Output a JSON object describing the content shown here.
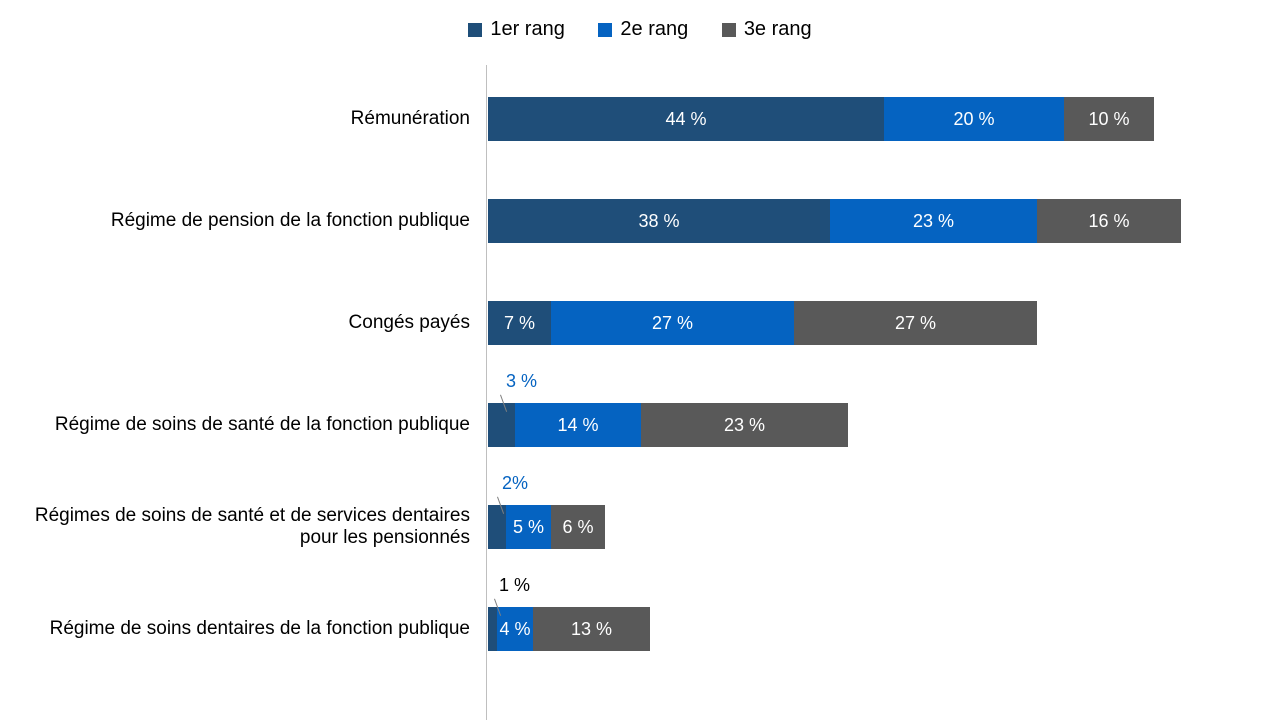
{
  "chart_data": {
    "type": "bar",
    "orientation": "horizontal",
    "stacked": true,
    "title": "",
    "xlabel": "",
    "ylabel": "",
    "xlim": [
      0,
      77
    ],
    "unit": "%",
    "categories": [
      "Rémunération",
      "Régime de pension de la fonction publique",
      "Congés payés",
      "Régime de soins de santé de la fonction publique",
      "Régimes de soins de santé et de services dentaires pour les pensionnés",
      "Régime de soins dentaires de la fonction publique"
    ],
    "series": [
      {
        "name": "1er rang",
        "color": "#1f4e79",
        "values": [
          44,
          38,
          7,
          3,
          2,
          1
        ]
      },
      {
        "name": "2e rang",
        "color": "#0563c1",
        "values": [
          20,
          23,
          27,
          14,
          5,
          4
        ]
      },
      {
        "name": "3e rang",
        "color": "#595959",
        "values": [
          10,
          16,
          27,
          23,
          6,
          13
        ]
      }
    ],
    "data_labels": [
      [
        "44 %",
        "20 %",
        "10 %"
      ],
      [
        "38 %",
        "23 %",
        "16 %"
      ],
      [
        "7 %",
        "27 %",
        "27 %"
      ],
      [
        "3 %",
        "14 %",
        "23 %"
      ],
      [
        "2%",
        "5 %",
        "6 %"
      ],
      [
        "1 %",
        "4 %",
        "13 %"
      ]
    ]
  },
  "legend": {
    "items": [
      "1er rang",
      "2e rang",
      "3e rang"
    ],
    "colors": [
      "#1f4e79",
      "#0563c1",
      "#595959"
    ]
  }
}
